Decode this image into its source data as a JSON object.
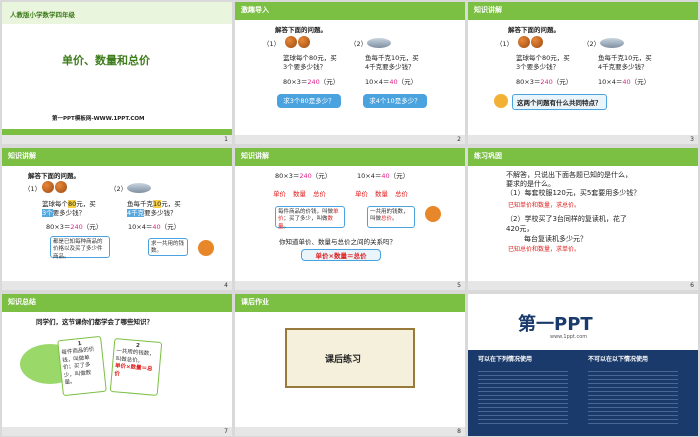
{
  "slides": [
    {
      "num": "1",
      "brand": "人教版小学数学四年级",
      "title": "单价、数量和总价",
      "site": "第一PPT模板网-WWW.1PPT.COM"
    },
    {
      "num": "2",
      "header": "激趣导入",
      "intro": "解答下面的问题。",
      "p1": "（1）",
      "p2": "（2）",
      "q1a": "篮球每个80元，买",
      "q1b": "3个要多少钱？",
      "q2a": "鱼每千克10元，买",
      "q2b": "4千克要多少钱？",
      "e1": "80×3＝",
      "e1v": "240",
      "e1u": "（元）",
      "e2": "10×4＝",
      "e2v": "40",
      "e2u": "（元）",
      "b1": "求3个80是多少？",
      "b2": "求4个10是多少？"
    },
    {
      "num": "3",
      "header": "知识讲解",
      "intro": "解答下面的问题。",
      "p1": "（1）",
      "p2": "（2）",
      "q1a": "篮球每个80元，买",
      "q1b": "3个要多少钱？",
      "q2a": "鱼每千克10元，买",
      "q2b": "4千克要多少钱？",
      "e1": "80×3＝",
      "e1v": "240",
      "e1u": "（元）",
      "e2": "10×4＝",
      "e2v": "40",
      "e2u": "（元）",
      "ask": "这两个问题有什么共同特点？"
    },
    {
      "num": "4",
      "header": "知识讲解",
      "intro": "解答下面的问题。",
      "p1": "（1）",
      "p2": "（2）",
      "q1a": "篮球每个",
      "q1n": "80",
      "q1a2": "元，买",
      "q1b": "3个",
      "q1b2": "要多少钱？",
      "q2a": "鱼每千克",
      "q2n": "10",
      "q2a2": "元，买",
      "q2b": "4千克",
      "q2b2": "要多少钱？",
      "e1": "80×3＝",
      "e1v": "240",
      "e1u": "（元）",
      "e2": "10×4＝",
      "e2v": "40",
      "e2u": "（元）",
      "n1": "都是已知每种商品的价格以及买了多少件商品。",
      "n2": "求一共用的钱数。"
    },
    {
      "num": "5",
      "header": "知识讲解",
      "e1": "80×3＝",
      "e1v": "240",
      "e1u": "（元）",
      "e2": "10×4＝",
      "e2v": "40",
      "e2u": "（元）",
      "d1": "单价",
      "d2": "数量",
      "d3": "总价",
      "n1a": "每件商品的价钱，叫做",
      "n1b": "单价",
      "n1c": "；买了多少，叫做",
      "n1d": "数量",
      "n1e": "。",
      "n2a": "一共用的钱数，叫做",
      "n2b": "总价",
      "n2c": "。",
      "ask": "你知道单价、数量与总价之间的关系吗？",
      "formula": "单价×数量＝总价"
    },
    {
      "num": "6",
      "header": "练习巩固",
      "l1": "不解答，只说出下面各题已知的是什么，",
      "l2": "要求的是什么。",
      "l3": "（1）每套校服120元，买5套要用多少钱？",
      "a1": "已知单价和数量，求总价。",
      "l4": "（2）学校买了3台同样的复读机，花了",
      "l5": "420元，",
      "l6": "每台复读机多少元？",
      "a2": "已知总价和数量，求单价。"
    },
    {
      "num": "7",
      "header": "知识总结",
      "ask": "同学们，这节课你们都学会了哪些知识？",
      "c1n": "1",
      "c1": "每件商品的价钱，叫做单价；买了多少，叫做数量。",
      "c2n": "2",
      "c2": "一共用的钱数，叫做总价。",
      "c2f": "单价×数量＝总价"
    },
    {
      "num": "8",
      "header": "课后作业",
      "task": "课后练习"
    },
    {
      "num": "",
      "logo": "第一PPT",
      "tag": "www.1ppt.com",
      "h1": "可以在下列情况使用",
      "h2": "不可以在以下情况使用"
    }
  ],
  "colors": {
    "green": "#7bbf43",
    "blue": "#4aa3df",
    "red": "#e02020",
    "dark": "#1a3a6b"
  }
}
